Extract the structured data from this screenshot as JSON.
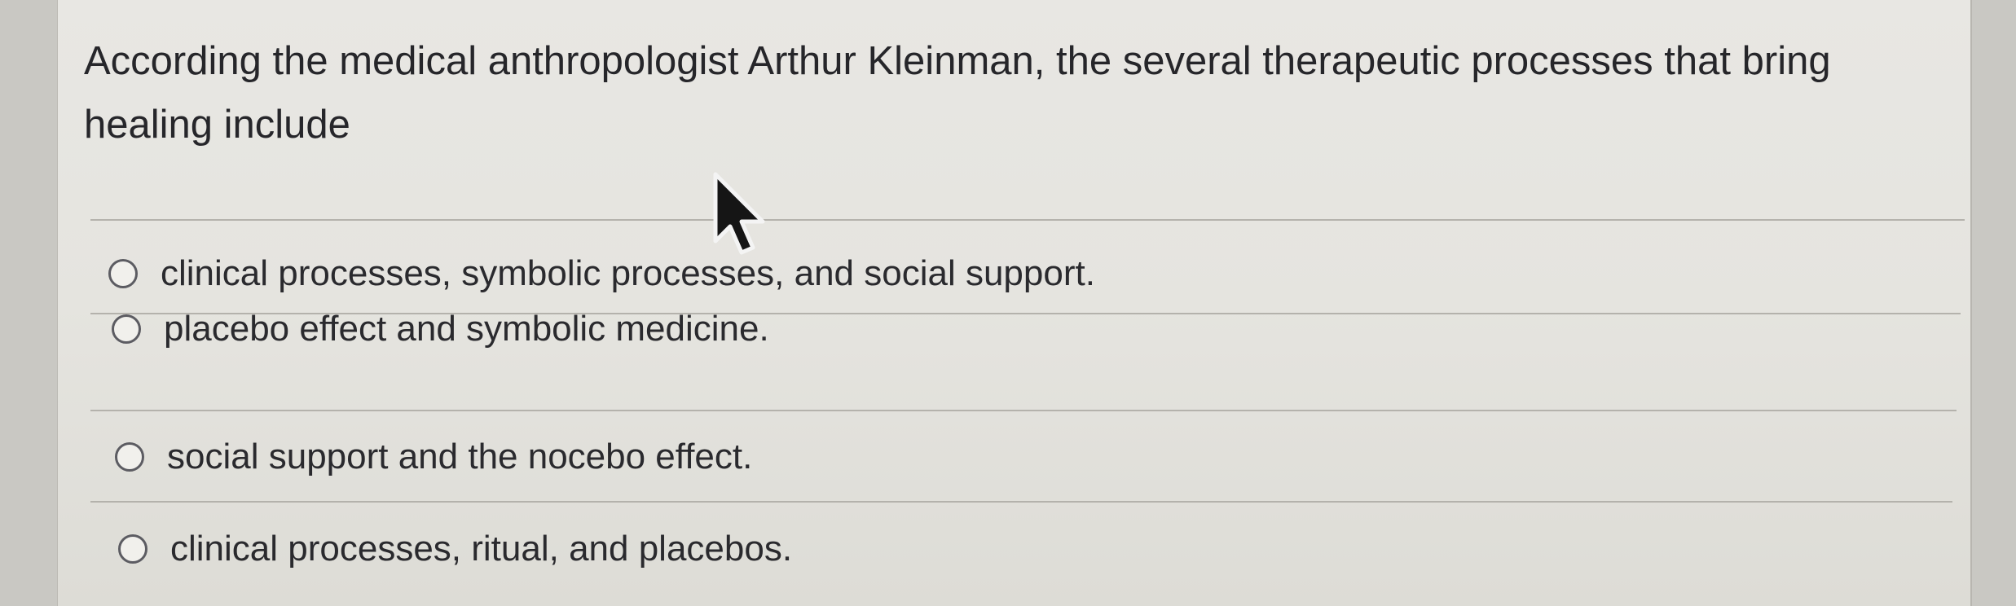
{
  "question": {
    "text": "According the medical anthropologist Arthur Kleinman, the several therapeutic processes that bring healing include"
  },
  "options": [
    {
      "label": "clinical processes, symbolic processes, and social support.",
      "selected": false
    },
    {
      "label": "placebo effect and symbolic medicine.",
      "selected": false
    },
    {
      "label": "social support and the nocebo effect.",
      "selected": false
    },
    {
      "label": "clinical processes, ritual, and placebos.",
      "selected": false
    }
  ],
  "icons": {
    "cursor": "mouse-pointer-icon",
    "radio": "radio-unchecked-icon"
  },
  "colors": {
    "panel_background": "#e6e5e0",
    "text": "#26262a",
    "radio_border": "#5c5c62"
  }
}
